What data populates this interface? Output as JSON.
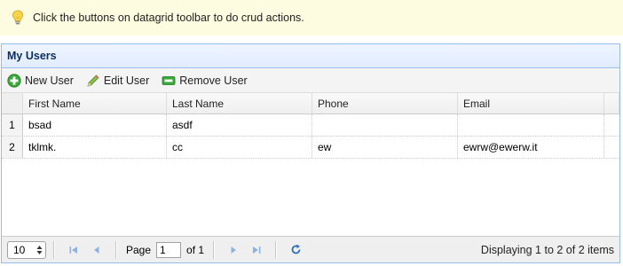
{
  "tip": {
    "icon": "lightbulb-icon",
    "text": "Click the buttons on datagrid toolbar to do crud actions."
  },
  "panel": {
    "title": "My Users"
  },
  "toolbar": {
    "new_user": "New User",
    "edit_user": "Edit User",
    "remove_user": "Remove User"
  },
  "grid": {
    "columns": [
      "First Name",
      "Last Name",
      "Phone",
      "Email"
    ],
    "rows": [
      {
        "num": "1",
        "first": "bsad",
        "last": "asdf",
        "phone": "",
        "email": ""
      },
      {
        "num": "2",
        "first": "tklmk.",
        "last": "cc",
        "phone": "ew",
        "email": "ewrw@ewerw.it"
      }
    ]
  },
  "pager": {
    "page_size": "10",
    "page_label": "Page",
    "page_value": "1",
    "of_label": "of 1",
    "info": "Displaying 1 to 2 of 2 items"
  },
  "colors": {
    "tip_bg": "#fefce0",
    "panel_border": "#99bbe8",
    "header_text": "#0e2d5f",
    "add_green": "#2e9d2e",
    "nav_blue": "#7ea7d8"
  }
}
